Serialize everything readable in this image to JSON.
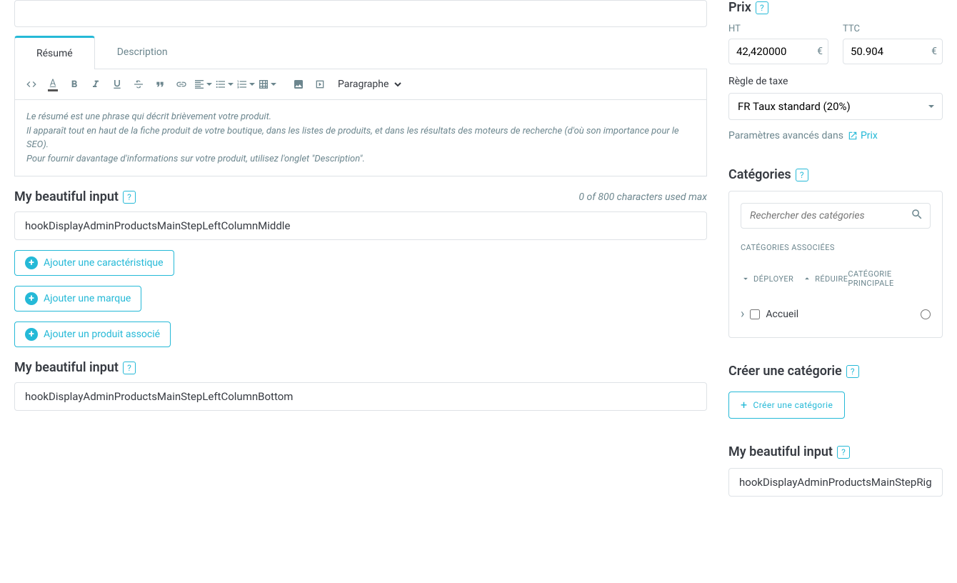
{
  "tabs": {
    "resume": "Résumé",
    "description": "Description"
  },
  "toolbar": {
    "format": "Paragraphe"
  },
  "editor_placeholder": {
    "l1": "Le résumé est une phrase qui décrit brièvement votre produit.",
    "l2": "Il apparaît tout en haut de la fiche produit de votre boutique, dans les listes de produits, et dans les résultats des moteurs de recherche (d'où son importance pour le SEO).",
    "l3": "Pour fournir davantage d'informations sur votre produit, utilisez l'onglet \"Description\"."
  },
  "input1": {
    "label": "My beautiful input",
    "value": "hookDisplayAdminProductsMainStepLeftColumnMiddle",
    "charcount": "0 of 800 characters used max"
  },
  "add_buttons": {
    "feature": "Ajouter une caractéristique",
    "brand": "Ajouter une marque",
    "related": "Ajouter un produit associé"
  },
  "input2": {
    "label": "My beautiful input",
    "value": "hookDisplayAdminProductsMainStepLeftColumnBottom"
  },
  "price": {
    "title": "Prix",
    "ht_label": "HT",
    "ht_value": "42,420000",
    "ttc_label": "TTC",
    "ttc_value": "50.904",
    "currency": "€",
    "tax_rule_label": "Règle de taxe",
    "tax_rule_value": "FR Taux standard (20%)",
    "adv_text": "Paramètres avancés dans",
    "adv_link": "Prix"
  },
  "categories": {
    "title": "Catégories",
    "search_placeholder": "Rechercher des catégories",
    "assoc_label": "CATÉGORIES ASSOCIÉES",
    "expand": "DÉPLOYER",
    "collapse": "RÉDUIRE",
    "main_cat": "CATÉGORIE PRINCIPALE",
    "item1": "Accueil"
  },
  "create_cat": {
    "title": "Créer une catégorie",
    "btn": "Créer une catégorie"
  },
  "input3": {
    "label": "My beautiful input",
    "value": "hookDisplayAdminProductsMainStepRight"
  }
}
